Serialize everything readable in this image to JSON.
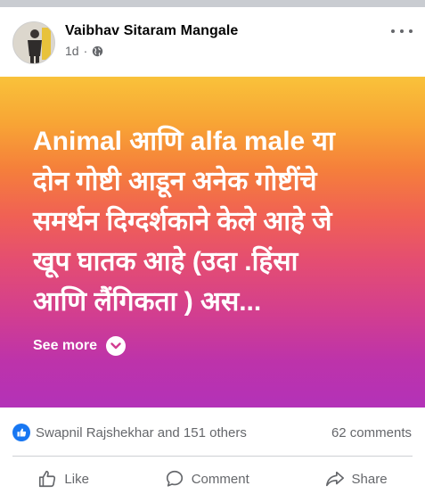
{
  "post": {
    "author": "Vaibhav Sitaram Mangale",
    "time": "1d",
    "separator": "·",
    "privacy_icon": "globe-icon",
    "text": "Animal आणि alfa male या\nदोन गोष्टी आडून अनेक गोष्टींचे\nसमर्थन दिग्दर्शकाने केले आहे जे\nखूप घातक आहे (उदा .हिंसा\nआणि लैंगिकता ) अस...",
    "see_more": "See more",
    "gradient_colors": [
      "#f9c23a",
      "#f57f3b",
      "#e44d72",
      "#b332b8"
    ]
  },
  "reactions": {
    "summary": "Swapnil Rajshekhar and 151 others",
    "comments": "62 comments",
    "badge_color": "#1877f2"
  },
  "actions": {
    "like": "Like",
    "comment": "Comment",
    "share": "Share"
  }
}
